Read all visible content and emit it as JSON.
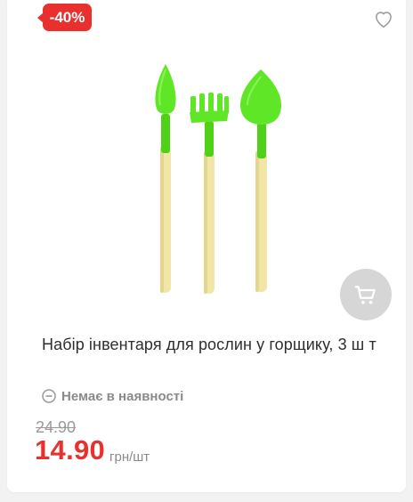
{
  "product": {
    "discount_badge": "-40%",
    "title": "Набір інвентаря для рослин у горщику, 3 ш т",
    "availability": "Немає в наявності",
    "old_price": "24.90",
    "new_price": "14.90",
    "unit": "грн/шт",
    "favorite": false
  },
  "icons": {
    "favorite": "heart-outline-icon",
    "cart": "cart-icon",
    "availability": "minus-circle-icon"
  },
  "colors": {
    "badge": "#e8312f",
    "price": "#e8312f",
    "tool_head": "#5fe626",
    "tool_handle": "#f1e6a6"
  }
}
